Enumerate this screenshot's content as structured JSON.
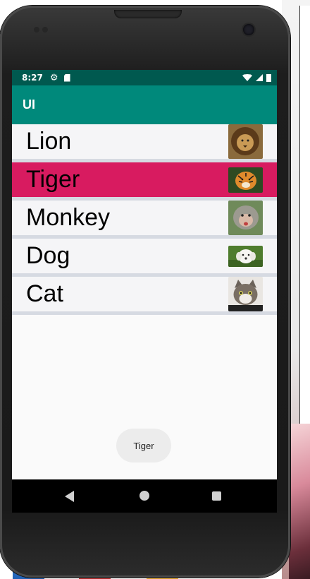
{
  "status_bar": {
    "time": "8:27"
  },
  "app_bar": {
    "title": "UI"
  },
  "list": {
    "items": [
      {
        "label": "Lion",
        "icon": "lion-photo",
        "selected": false
      },
      {
        "label": "Tiger",
        "icon": "tiger-photo",
        "selected": true
      },
      {
        "label": "Monkey",
        "icon": "monkey-photo",
        "selected": false
      },
      {
        "label": "Dog",
        "icon": "dog-photo",
        "selected": false
      },
      {
        "label": "Cat",
        "icon": "cat-photo",
        "selected": false
      }
    ]
  },
  "toast": {
    "text": "Tiger"
  },
  "nav_bar": {
    "icons": [
      "back-icon",
      "home-icon",
      "recents-icon"
    ]
  },
  "colors": {
    "status_bar": "#00594f",
    "app_bar": "#00897b",
    "selected_row": "#d81b60",
    "row": "#f5f5f7",
    "divider": "#d6dae2",
    "nav_bar": "#000000"
  }
}
